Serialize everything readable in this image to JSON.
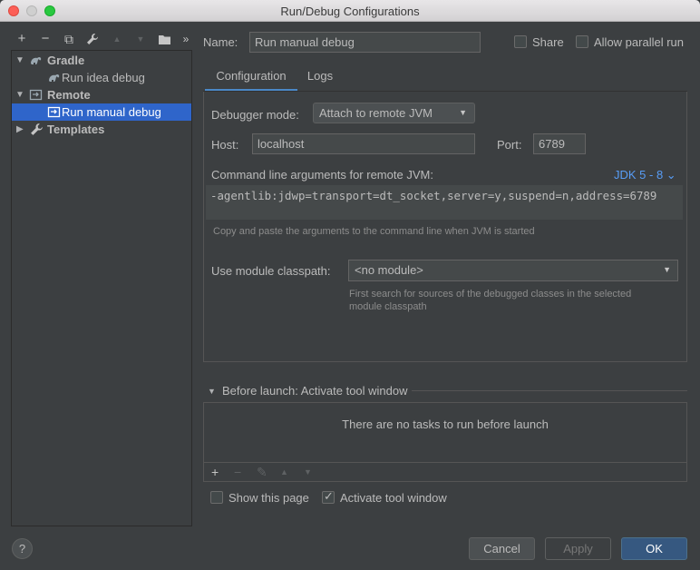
{
  "window": {
    "title": "Run/Debug Configurations"
  },
  "toolbar": {
    "add": "+",
    "remove": "−",
    "copy": "⧉",
    "edit": "✎",
    "move_up": "▲",
    "move_down": "▼",
    "folder": "▤",
    "more": "»"
  },
  "tree": {
    "items": [
      {
        "label": "Gradle",
        "icon": "gradle-icon",
        "expanded": true
      },
      {
        "label": "Run idea debug",
        "icon": "gradle-icon"
      },
      {
        "label": "Remote",
        "icon": "remote-icon",
        "expanded": true
      },
      {
        "label": "Run manual debug",
        "icon": "remote-icon",
        "selected": true
      },
      {
        "label": "Templates",
        "icon": "wrench-icon",
        "expanded": false
      }
    ]
  },
  "header": {
    "name_label": "Name:",
    "name_value": "Run manual debug",
    "share_label": "Share",
    "parallel_label": "Allow parallel run"
  },
  "tabs": [
    {
      "label": "Configuration"
    },
    {
      "label": "Logs"
    }
  ],
  "config": {
    "debugger_mode_label": "Debugger mode:",
    "debugger_mode_value": "Attach to remote JVM",
    "host_label": "Host:",
    "host_value": "localhost",
    "port_label": "Port:",
    "port_value": "6789",
    "cmdline_label": "Command line arguments for remote JVM:",
    "jdk_link": "JDK 5 - 8 ⌄",
    "cmdline_value": "-agentlib:jdwp=transport=dt_socket,server=y,suspend=n,address=6789",
    "cmdline_hint": "Copy and paste the arguments to the command line when JVM is started",
    "module_label": "Use module classpath:",
    "module_value": "<no module>",
    "module_hint_1": "First search for sources of the debugged classes in the selected",
    "module_hint_2": "module classpath"
  },
  "before_launch": {
    "title": "Before launch: Activate tool window",
    "empty_text": "There are no tasks to run before launch",
    "tools": {
      "add": "+",
      "remove": "−",
      "edit": "✎",
      "up": "▲",
      "down": "▼"
    }
  },
  "options": {
    "show_page_label": "Show this page",
    "activate_label": "Activate tool window"
  },
  "buttons": {
    "help": "?",
    "cancel": "Cancel",
    "apply": "Apply",
    "ok": "OK"
  },
  "colors": {
    "accent": "#2f65ca",
    "link": "#589df6",
    "primary_button": "#365880",
    "background": "#3c3f41"
  }
}
